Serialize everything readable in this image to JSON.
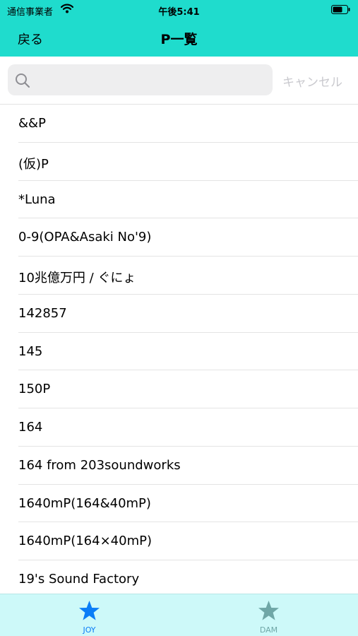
{
  "status_bar": {
    "carrier": "通信事業者",
    "time": "午後5:41"
  },
  "nav": {
    "back_label": "戻る",
    "title": "P一覧"
  },
  "search": {
    "value": "",
    "placeholder": "",
    "cancel_label": "キャンセル"
  },
  "list": {
    "items": [
      "&&P",
      "(仮)P",
      "*Luna",
      "0-9(OPA&Asaki No'9)",
      "10兆億万円 / ぐにょ",
      "142857",
      "145",
      "150P",
      "164",
      "164 from 203soundworks",
      "1640mP(164&40mP)",
      "1640mP(164×40mP)",
      "19's Sound Factory"
    ]
  },
  "tabs": [
    {
      "label": "JOY",
      "selected": true,
      "color": "#0a7df7"
    },
    {
      "label": "DAM",
      "selected": false,
      "color": "#6fa7a7"
    }
  ],
  "colors": {
    "accent": "#1fdccd",
    "tab_bar_bg": "#cdf9f9",
    "cancel": "#c9c9ce"
  },
  "icons": {
    "wifi": "wifi-icon",
    "battery": "battery-icon",
    "search": "search-icon",
    "tab": "star-icon"
  }
}
